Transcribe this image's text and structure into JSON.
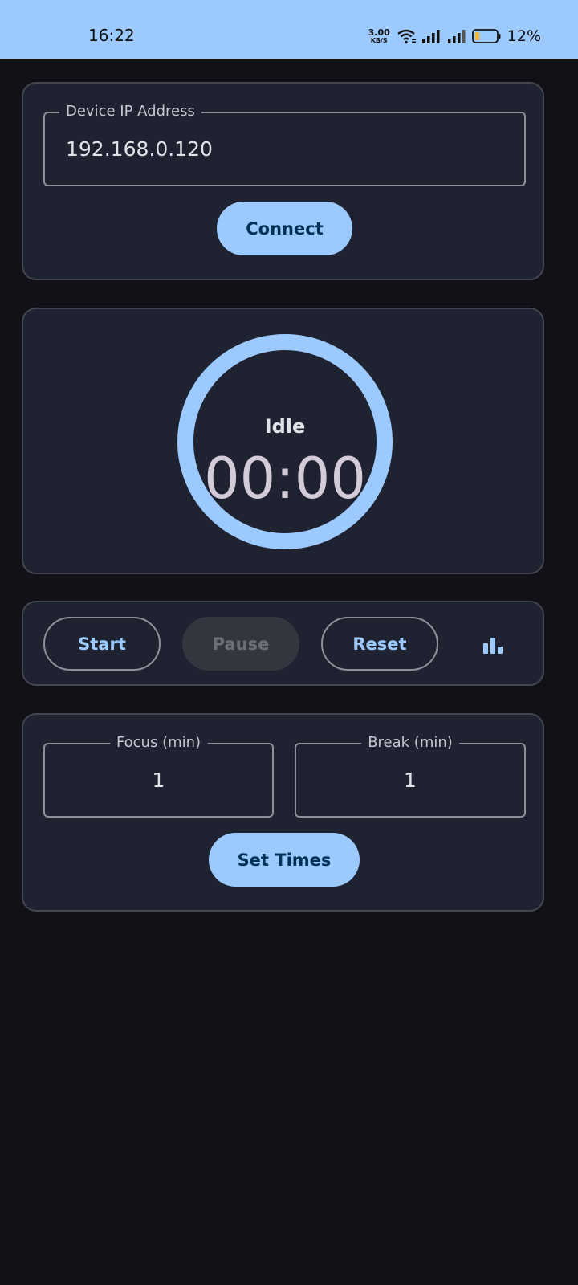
{
  "status_bar": {
    "time": "16:22",
    "net_speed_value": "3.00",
    "net_speed_unit": "KB/S",
    "battery_percent": "12%",
    "icons": [
      "wifi-icon",
      "signal-icon",
      "signal-icon",
      "battery-icon"
    ]
  },
  "connection": {
    "ip_label": "Device IP Address",
    "ip_value": "192.168.0.120",
    "connect_label": "Connect"
  },
  "timer": {
    "state": "Idle",
    "time": "00:00",
    "ring_color": "#9ccaff"
  },
  "controls": {
    "start_label": "Start",
    "pause_label": "Pause",
    "reset_label": "Reset",
    "stats_icon": "bar-chart-icon"
  },
  "times": {
    "focus_label": "Focus (min)",
    "focus_value": "1",
    "break_label": "Break (min)",
    "break_value": "1",
    "set_label": "Set Times"
  },
  "colors": {
    "accent": "#9ccaff",
    "background": "#121118",
    "card": "#1f2230"
  }
}
